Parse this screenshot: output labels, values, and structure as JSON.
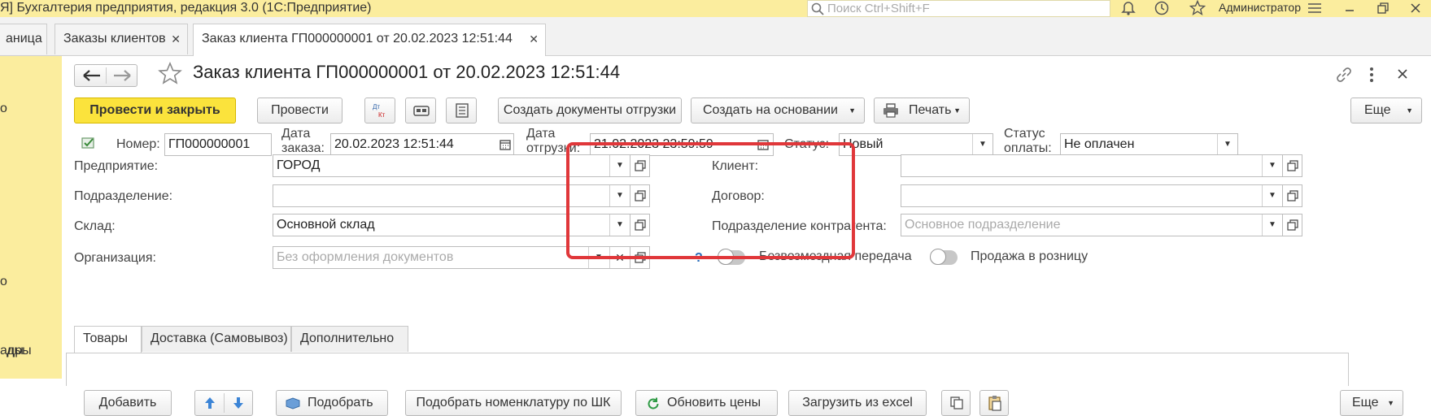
{
  "app": {
    "title": "Я] Бухгалтерия предприятия, редакция 3.0  (1С:Предприятие)",
    "search_placeholder": "Поиск Ctrl+Shift+F",
    "user": "Администратор"
  },
  "tabs": [
    {
      "label": "аница"
    },
    {
      "label": "Заказы клиентов"
    },
    {
      "label": "Заказ клиента ГП000000001 от 20.02.2023 12:51:44"
    }
  ],
  "left_panel": [
    "о",
    "о",
    "ды",
    "адры"
  ],
  "form": {
    "title": "Заказ клиента ГП000000001 от 20.02.2023 12:51:44",
    "toolbar": {
      "post_close": "Провести и закрыть",
      "post": "Провести",
      "dt_kt": "Дт Кт",
      "create_shipping": "Создать документы отгрузки",
      "create_based": "Создать на основании",
      "print": "Печать",
      "more": "Еще"
    },
    "number_label": "Номер:",
    "number_value": "ГП000000001",
    "order_date_label_1": "Дата",
    "order_date_label_2": "заказа:",
    "order_date_value": "20.02.2023 12:51:44",
    "ship_date_label_1": "Дата",
    "ship_date_label_2": "отгрузки:",
    "ship_date_value": "21.02.2023 23:59:59",
    "status_label": "Статус:",
    "status_value": "Новый",
    "pay_status_label_1": "Статус",
    "pay_status_label_2": "оплаты:",
    "pay_status_value": "Не оплачен",
    "enterprise_label": "Предприятие:",
    "enterprise_value": "ГОРОД",
    "client_label": "Клиент:",
    "client_value": "",
    "division_label": "Подразделение:",
    "division_value": "",
    "contract_label": "Договор:",
    "contract_value": "",
    "warehouse_label": "Склад:",
    "warehouse_value": "Основной склад",
    "counterparty_div_label": "Подразделение контрагента:",
    "counterparty_div_placeholder": "Основное подразделение",
    "organization_label": "Организация:",
    "organization_placeholder": "Без оформления документов",
    "help_mark": "?",
    "free_transfer_label": "Безвозмездная передача",
    "retail_sale_label": "Продажа в розницу",
    "section_tabs": [
      "Товары",
      "Доставка (Самовывоз)",
      "Дополнительно"
    ],
    "table_toolbar": {
      "add": "Добавить",
      "pick": "Подобрать",
      "pick_barcode": "Подобрать номенклатуру по ШК",
      "update_prices": "Обновить цены",
      "load_excel": "Загрузить из excel",
      "more": "Еще"
    }
  },
  "colors": {
    "title_bar": "#fbed9e",
    "primary_button": "#fbe33c",
    "highlight_box": "#e0373a"
  }
}
